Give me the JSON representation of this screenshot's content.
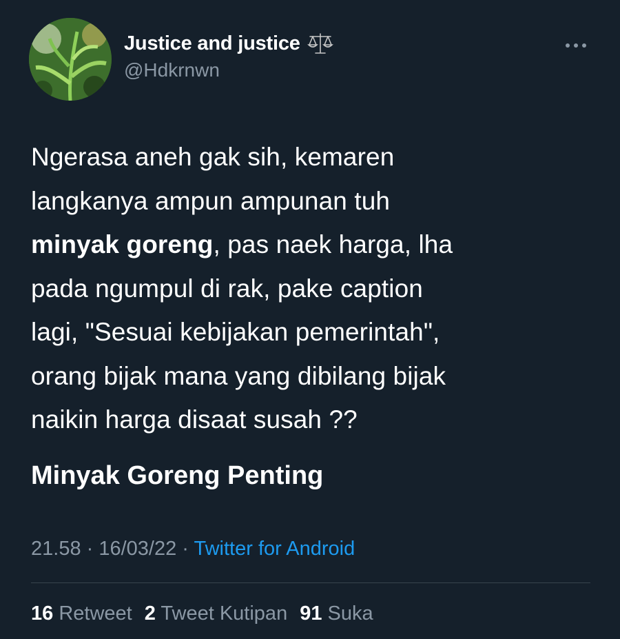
{
  "user": {
    "display_name": "Justice and justice",
    "handle": "@Hdkrnwn",
    "badge_icon": "balance-scale-icon",
    "more_icon": "more-options-icon"
  },
  "tweet": {
    "lines": [
      {
        "text": "Ngerasa aneh gak sih, kemaren"
      },
      {
        "text": "langkanya ampun ampunan tuh"
      },
      {
        "bold": "minyak goreng",
        "text": ", pas naek harga, lha"
      },
      {
        "text": "pada ngumpul di rak, pake caption"
      },
      {
        "text": "lagi, \"Sesuai kebijakan pemerintah\","
      },
      {
        "text": "orang bijak mana yang dibilang bijak"
      },
      {
        "text": "naikin harga disaat susah ??"
      }
    ],
    "hashtag_line": "Minyak Goreng Penting"
  },
  "meta": {
    "time": "21.58",
    "separator": " · ",
    "date": "16/03/22",
    "source": "Twitter for Android"
  },
  "stats": {
    "retweets_count": "16",
    "retweets_label": "Retweet",
    "quotes_count": "2",
    "quotes_label": "Tweet Kutipan",
    "likes_count": "91",
    "likes_label": "Suka"
  },
  "colors": {
    "background": "#15202b",
    "text_primary": "#ffffff",
    "text_secondary": "#8b98a5",
    "link": "#1d9bf0",
    "divider": "#38444d"
  }
}
